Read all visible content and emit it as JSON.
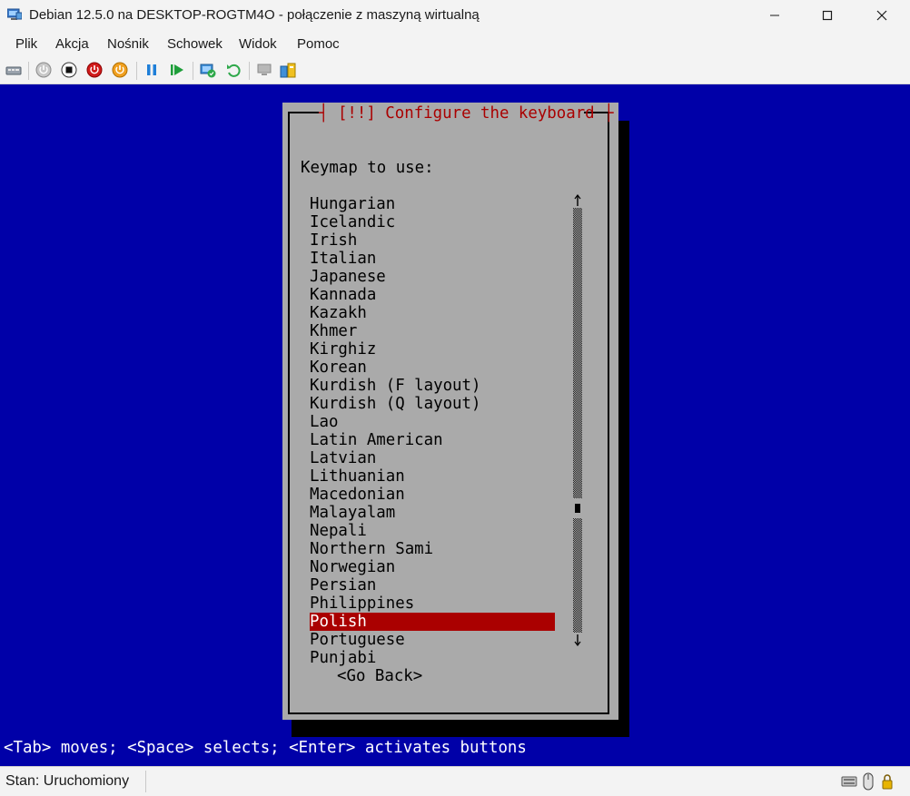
{
  "window": {
    "title": "Debian 12.5.0 na DESKTOP-ROGTM4O - połączenie z maszyną wirtualną",
    "controls": [
      "minimize-icon",
      "maximize-icon",
      "close-icon"
    ]
  },
  "menu": [
    "Plik",
    "Akcja",
    "Nośnik",
    "Schowek",
    "Widok",
    "Pomoc"
  ],
  "toolbar": {
    "icons": [
      "ctrl-alt-del-icon",
      "start-icon",
      "turn-off-icon",
      "shut-down-icon",
      "save-state-icon",
      "pause-icon",
      "resume-icon",
      "checkpoint-icon",
      "revert-icon",
      "enhanced-session-icon",
      "share-icon"
    ]
  },
  "installer": {
    "title": "[!!] Configure the keyboard",
    "prompt": "Keymap to use:",
    "items": [
      "Hungarian",
      "Icelandic",
      "Irish",
      "Italian",
      "Japanese",
      "Kannada",
      "Kazakh",
      "Khmer",
      "Kirghiz",
      "Korean",
      "Kurdish (F layout)",
      "Kurdish (Q layout)",
      "Lao",
      "Latin American",
      "Latvian",
      "Lithuanian",
      "Macedonian",
      "Malayalam",
      "Nepali",
      "Northern Sami",
      "Norwegian",
      "Persian",
      "Philippines",
      "Polish",
      "Portuguese",
      "Punjabi"
    ],
    "selected": "Polish",
    "go_back": "<Go Back>",
    "hint": "<Tab> moves; <Space> selects; <Enter> activates buttons"
  },
  "status": {
    "text": "Stan: Uruchomiony"
  },
  "colors": {
    "vm_background": "#0000a8",
    "dialog": "#aaaaaa",
    "title_red": "#aa0000",
    "selection": "#aa0000"
  }
}
